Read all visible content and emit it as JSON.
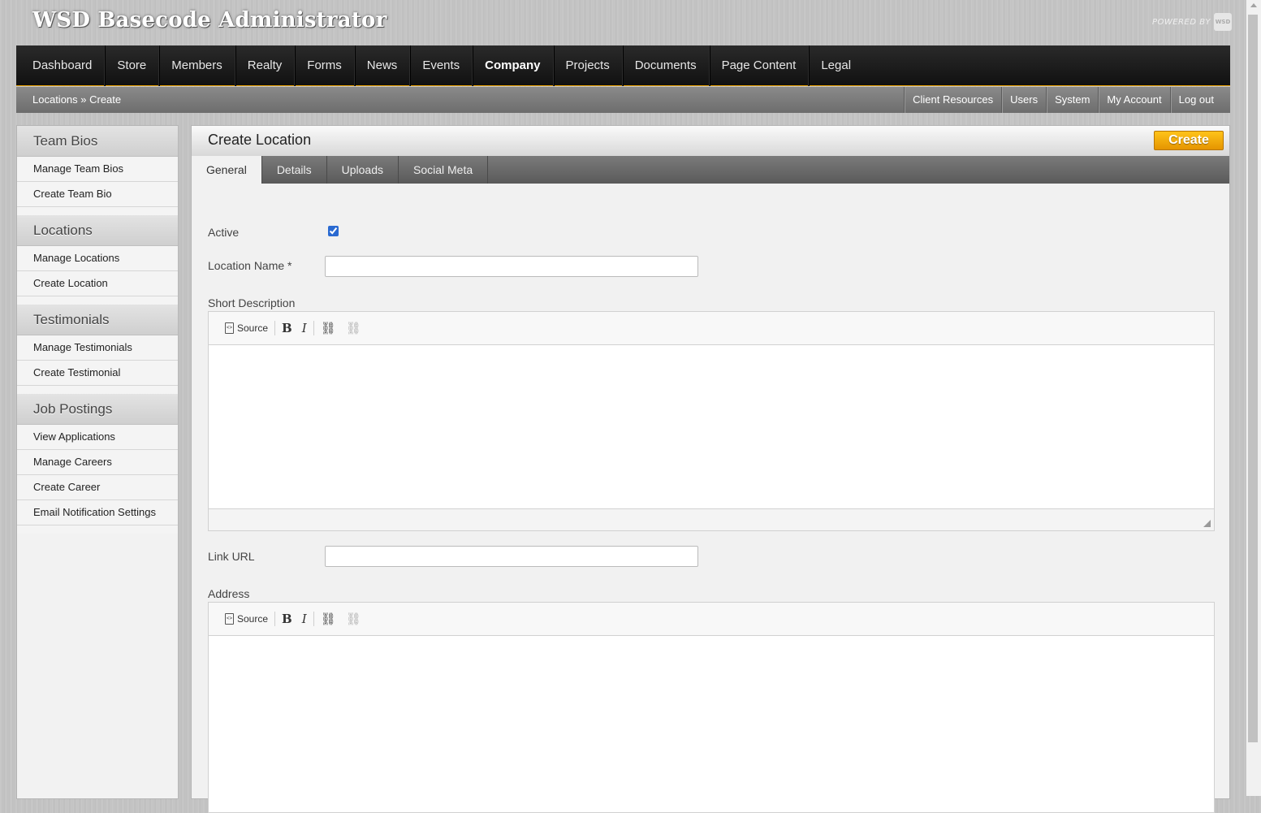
{
  "header": {
    "app_title": "WSD Basecode Administrator",
    "powered_by": "POWERED BY",
    "logo_text": "WSD"
  },
  "nav": {
    "items": [
      "Dashboard",
      "Store",
      "Members",
      "Realty",
      "Forms",
      "News",
      "Events",
      "Company",
      "Projects",
      "Documents",
      "Page Content",
      "Legal"
    ],
    "active": "Company"
  },
  "subnav": {
    "breadcrumb": "Locations » Create",
    "links": [
      "Client Resources",
      "Users",
      "System",
      "My Account",
      "Log out"
    ]
  },
  "sidebar": {
    "sections": [
      {
        "title": "Team Bios",
        "items": [
          "Manage Team Bios",
          "Create Team Bio"
        ]
      },
      {
        "title": "Locations",
        "items": [
          "Manage Locations",
          "Create Location"
        ]
      },
      {
        "title": "Testimonials",
        "items": [
          "Manage Testimonials",
          "Create Testimonial"
        ]
      },
      {
        "title": "Job Postings",
        "items": [
          "View Applications",
          "Manage Careers",
          "Create Career",
          "Email Notification Settings"
        ]
      }
    ]
  },
  "content": {
    "title": "Create Location",
    "create_label": "Create",
    "tabs": [
      "General",
      "Details",
      "Uploads",
      "Social Meta"
    ],
    "active_tab": "General"
  },
  "form": {
    "active_label": "Active",
    "active_checked": true,
    "location_name_label": "Location Name *",
    "location_name_value": "",
    "short_description_label": "Short Description",
    "link_url_label": "Link URL",
    "link_url_value": "",
    "address_label": "Address",
    "toolbar_source_label": "Source"
  },
  "icons": {
    "source": "source-icon",
    "bold": "bold-icon",
    "italic": "italic-icon",
    "link": "link-icon",
    "unlink": "unlink-icon"
  },
  "colors": {
    "accent": "#f0a800",
    "nav_bg": "#1a1a1a",
    "checkbox": "#2a6ad1"
  }
}
